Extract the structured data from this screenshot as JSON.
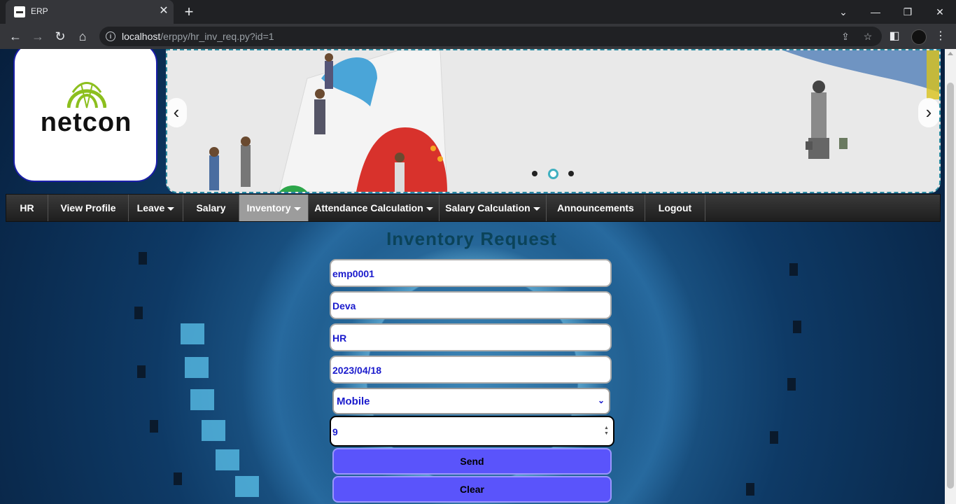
{
  "browser": {
    "tab_title": "ERP",
    "url_host": "localhost",
    "url_path": "/erppy/hr_inv_req.py?id=1"
  },
  "logo": {
    "text": "netcon"
  },
  "menu": [
    {
      "label": "HR",
      "dropdown": false
    },
    {
      "label": "View Profile",
      "dropdown": false
    },
    {
      "label": "Leave",
      "dropdown": true
    },
    {
      "label": "Salary",
      "dropdown": false
    },
    {
      "label": "Inventory",
      "dropdown": true,
      "active": true
    },
    {
      "label": "Attendance Calculation",
      "dropdown": true
    },
    {
      "label": "Salary Calculation",
      "dropdown": true
    },
    {
      "label": "Announcements",
      "dropdown": false
    },
    {
      "label": "Logout",
      "dropdown": false
    }
  ],
  "form": {
    "title": "Inventory Request",
    "employee_id": "emp0001",
    "employee_name": "Deva",
    "department": "HR",
    "date": "2023/04/18",
    "item_selected": "Mobile",
    "quantity": "9",
    "send_label": "Send",
    "clear_label": "Clear"
  },
  "colors": {
    "field_text": "#1a1acc",
    "button_bg": "#5a54fb",
    "title": "#0b4359"
  }
}
